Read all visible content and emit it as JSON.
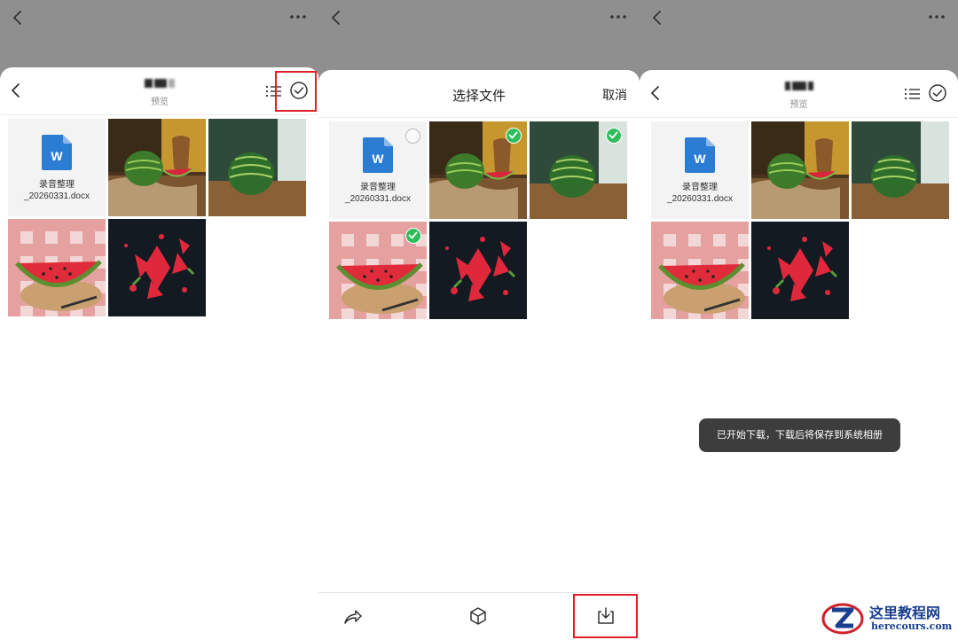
{
  "panel1": {
    "header": {
      "subtitle": "预览",
      "list_icon": "list-icon",
      "check_icon": "check-circle-icon"
    },
    "files": [
      {
        "type": "doc",
        "name_line1": "录音整理",
        "name_line2": "_20260331.docx",
        "icon": "word-doc-icon"
      },
      {
        "type": "photo",
        "name": "watermark-still-life-photo"
      },
      {
        "type": "photo",
        "name": "watermark-on-table-photo"
      },
      {
        "type": "photo",
        "name": "watermark-slice-photo"
      },
      {
        "type": "photo",
        "name": "watermark-splash-photo"
      }
    ]
  },
  "panel2": {
    "header": {
      "title": "选择文件",
      "cancel_label": "取消"
    },
    "files": [
      {
        "type": "doc",
        "name_line1": "录音整理",
        "name_line2": "_20260331.docx",
        "selected": false
      },
      {
        "type": "photo",
        "selected": true
      },
      {
        "type": "photo",
        "selected": true
      },
      {
        "type": "photo",
        "selected": true
      },
      {
        "type": "photo",
        "selected": false
      }
    ],
    "toolbar": {
      "share_icon": "share-icon",
      "box_icon": "box-icon",
      "download_icon": "download-icon"
    }
  },
  "panel3": {
    "header": {
      "subtitle": "预览"
    },
    "files": [
      {
        "type": "doc",
        "name_line1": "录音整理",
        "name_line2": "_20260331.docx"
      },
      {
        "type": "photo"
      },
      {
        "type": "photo"
      },
      {
        "type": "photo"
      },
      {
        "type": "photo"
      }
    ],
    "toast": "已开始下载，下载后将保存到系统相册"
  },
  "watermark": {
    "title": "这里教程网",
    "url": "herecours.com"
  },
  "colors": {
    "select_green": "#2fbd5b",
    "highlight_red": "#e0202a",
    "word_blue": "#2b7cd3",
    "toast_bg": "#3d3d3d"
  }
}
